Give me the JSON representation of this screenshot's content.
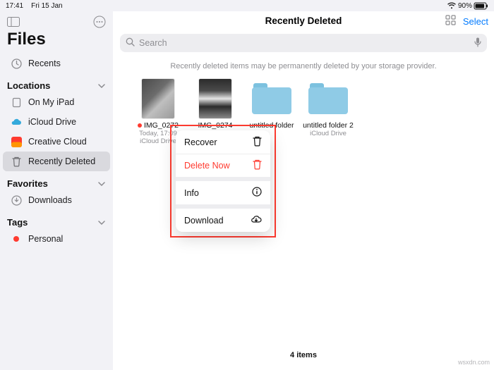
{
  "status": {
    "time": "17:41",
    "date": "Fri 15 Jan",
    "battery": "90%"
  },
  "app_title": "Files",
  "recents_label": "Recents",
  "sections": {
    "locations": {
      "title": "Locations",
      "items": [
        {
          "label": "On My iPad"
        },
        {
          "label": "iCloud Drive"
        },
        {
          "label": "Creative Cloud"
        },
        {
          "label": "Recently Deleted"
        }
      ]
    },
    "favorites": {
      "title": "Favorites",
      "items": [
        {
          "label": "Downloads"
        }
      ]
    },
    "tags": {
      "title": "Tags",
      "items": [
        {
          "label": "Personal",
          "color": "#ff3b30"
        }
      ]
    }
  },
  "header": {
    "title": "Recently Deleted",
    "select": "Select"
  },
  "search_placeholder": "Search",
  "notice": "Recently deleted items may be permanently deleted by your storage provider.",
  "items": [
    {
      "name": "IMG_0272",
      "sub1": "Today, 17:09",
      "sub2": "iCloud Drive"
    },
    {
      "name": "IMG_0274"
    },
    {
      "name": "untitled folder"
    },
    {
      "name": "untitled folder 2",
      "sub1": "iCloud Drive"
    }
  ],
  "menu": {
    "recover": "Recover",
    "delete": "Delete Now",
    "info": "Info",
    "download": "Download"
  },
  "footer": "4 items",
  "watermark": "wsxdn.com"
}
